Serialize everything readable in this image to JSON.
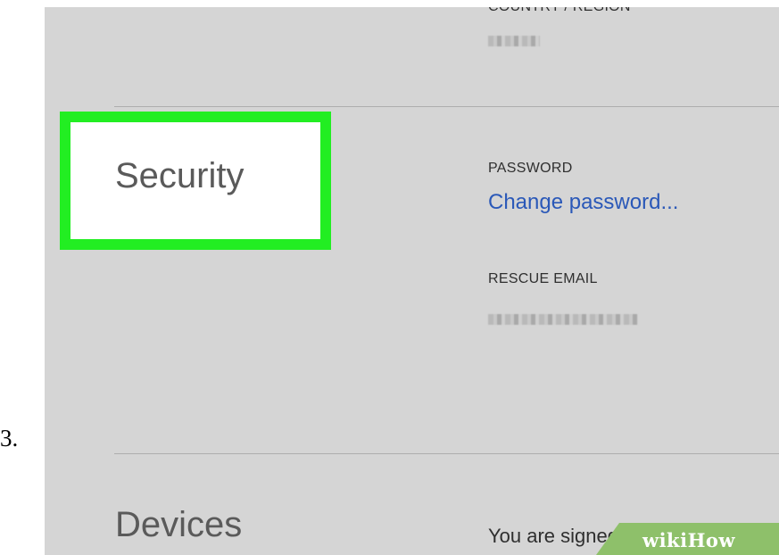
{
  "step": {
    "number": "3."
  },
  "account": {
    "country_label": "COUNTRY / REGION",
    "security_heading": "Security",
    "password_label": "PASSWORD",
    "change_password_link": "Change password...",
    "rescue_email_label": "RESCUE EMAIL",
    "devices_heading": "Devices",
    "devices_text": "You are signed in to the dev"
  },
  "highlight": {
    "color": "#22ee22"
  },
  "watermark": {
    "text": "wikiHow",
    "color": "#8ec06a"
  },
  "redactions": [
    "country-value",
    "rescue-email-value"
  ]
}
